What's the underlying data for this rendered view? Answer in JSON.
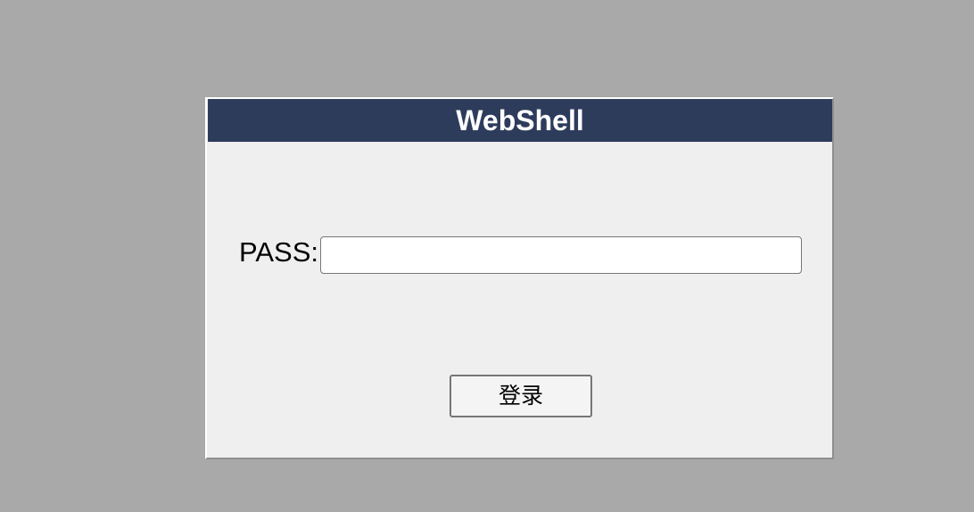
{
  "header": {
    "title": "WebShell"
  },
  "form": {
    "pass_label": "PASS:",
    "pass_value": "",
    "pass_placeholder": "",
    "submit_label": "登录"
  }
}
